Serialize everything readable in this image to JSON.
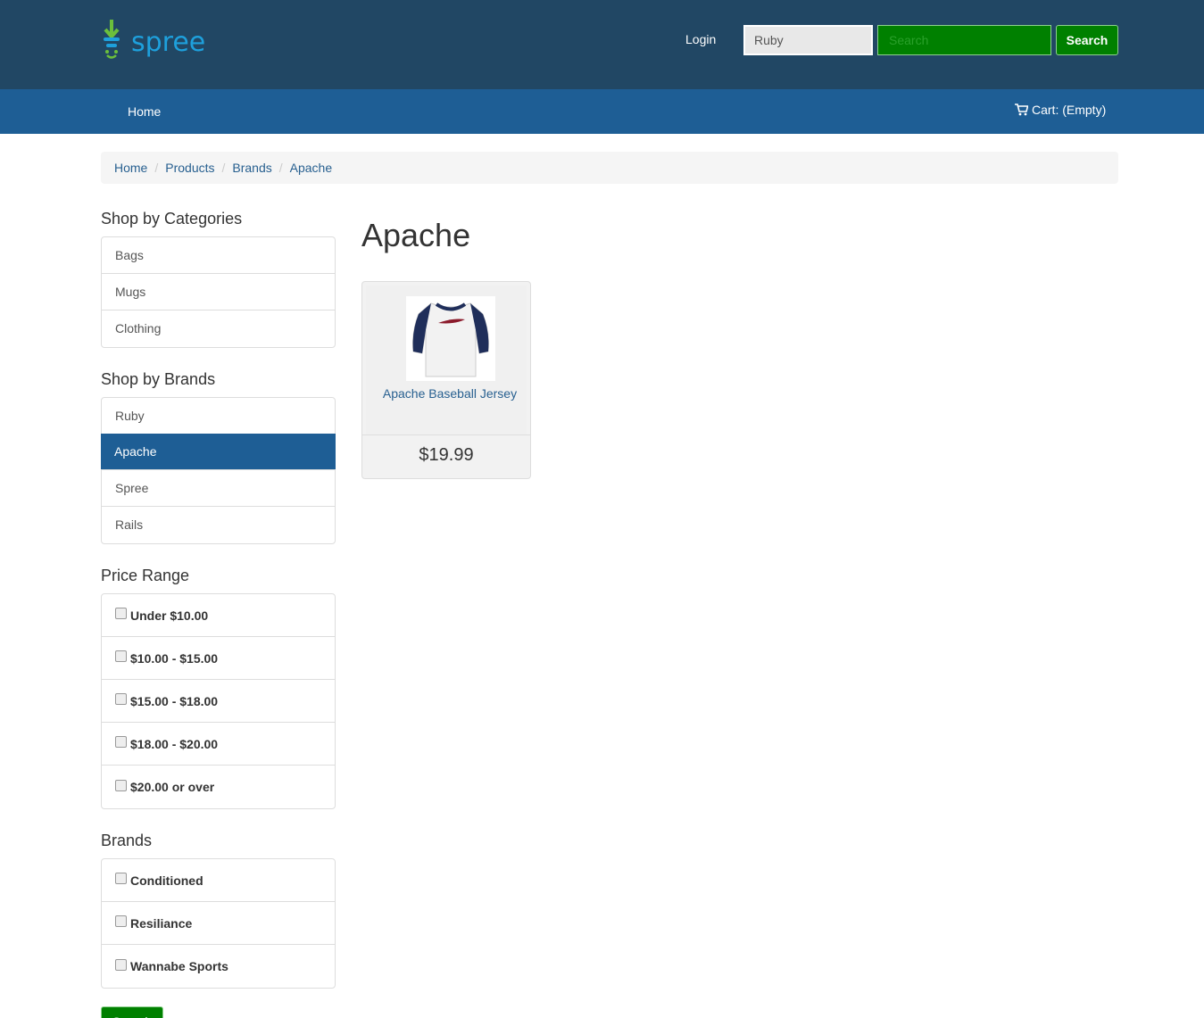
{
  "header": {
    "logo_text": "spree",
    "login_label": "Login",
    "taxon_select_value": "Ruby",
    "search_placeholder": "Search",
    "search_button": "Search"
  },
  "nav": {
    "home_label": "Home",
    "cart_label": "Cart: (Empty)"
  },
  "breadcrumb": [
    "Home",
    "Products",
    "Brands",
    "Apache"
  ],
  "sidebar": {
    "categories_title": "Shop by Categories",
    "categories": [
      "Bags",
      "Mugs",
      "Clothing"
    ],
    "brands_title": "Shop by Brands",
    "brands": [
      "Ruby",
      "Apache",
      "Spree",
      "Rails"
    ],
    "active_brand": "Apache",
    "price_title": "Price Range",
    "price_ranges": [
      "Under $10.00",
      "$10.00 - $15.00",
      "$15.00 - $18.00",
      "$18.00 - $20.00",
      "$20.00 or over"
    ],
    "brand_filter_title": "Brands",
    "brand_filters": [
      "Conditioned",
      "Resiliance",
      "Wannabe Sports"
    ],
    "search_button": "Search"
  },
  "main": {
    "title": "Apache",
    "products": [
      {
        "name": "Apache Baseball Jersey",
        "price": "$19.99"
      }
    ]
  },
  "colors": {
    "header_bg": "#214764",
    "navbar_bg": "#1e5e95",
    "button_green": "#008000",
    "link_blue": "#286090"
  }
}
